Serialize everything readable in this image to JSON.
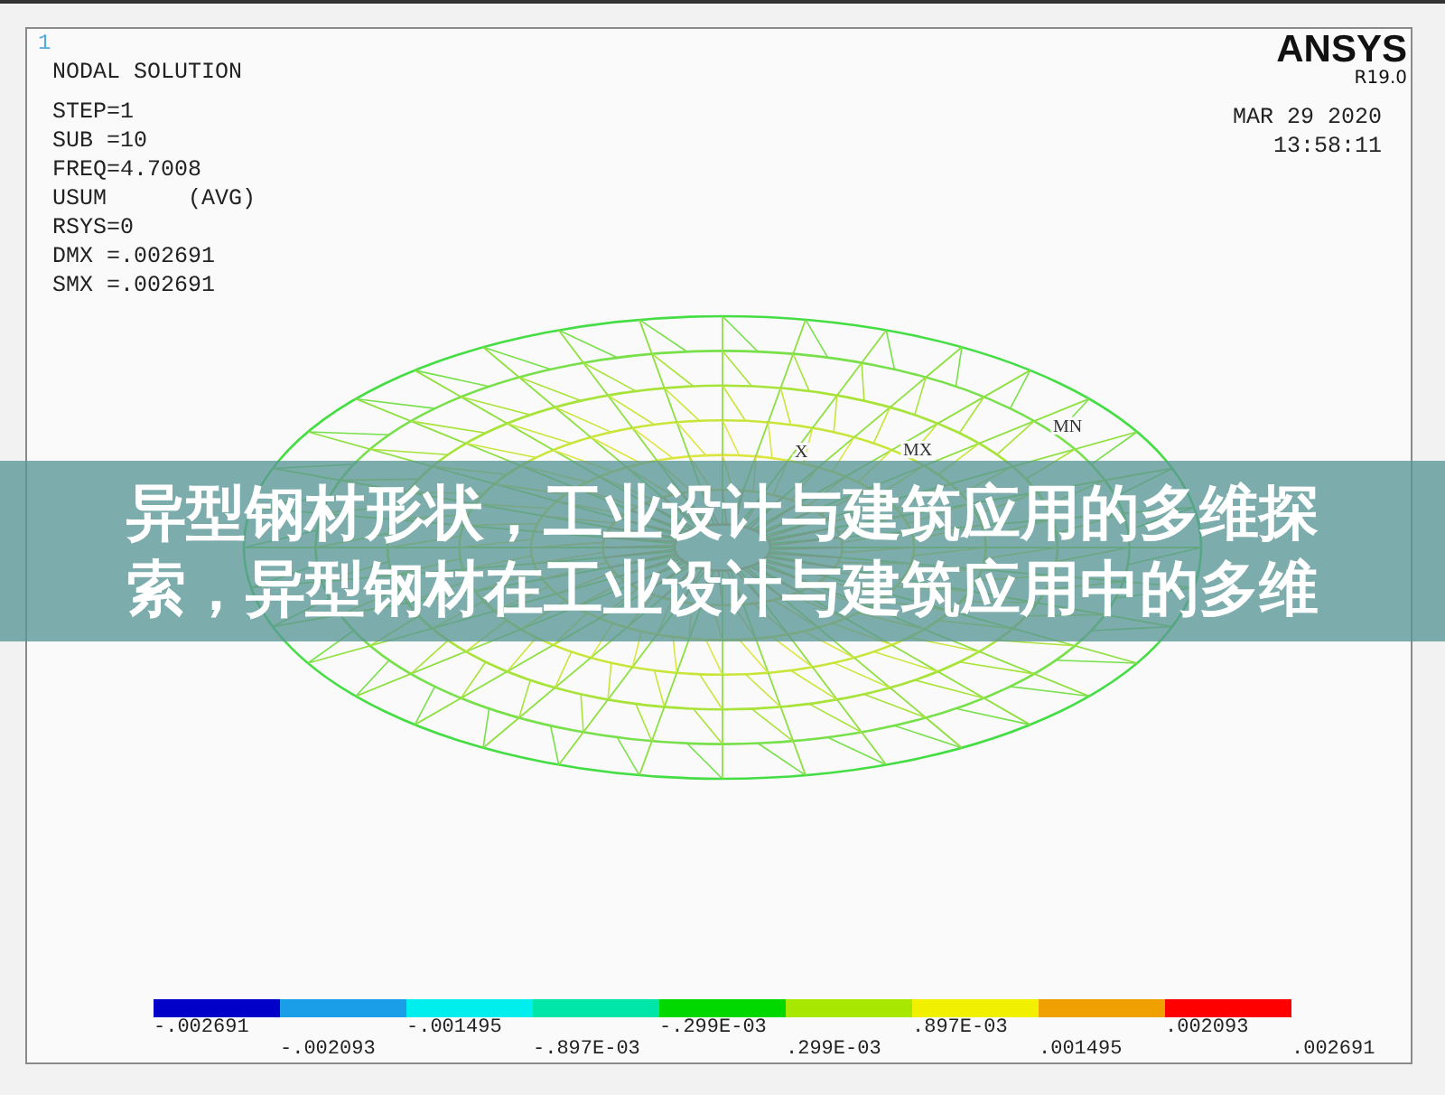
{
  "plot_number": "1",
  "title": "NODAL SOLUTION",
  "solution_info": [
    "STEP=1",
    "SUB =10",
    "FREQ=4.7008",
    "USUM      (AVG)",
    "RSYS=0",
    "DMX =.002691",
    "SMX =.002691"
  ],
  "logo": {
    "name": "ANSYS",
    "version": "R19.0"
  },
  "date": "MAR 29 2020",
  "time": "13:58:11",
  "plot_markers": [
    {
      "label": "MN"
    },
    {
      "label": "MX"
    },
    {
      "label": "X"
    }
  ],
  "legend": {
    "segments": [
      {
        "color": "#0000c8"
      },
      {
        "color": "#1a9ee8"
      },
      {
        "color": "#00eeee"
      },
      {
        "color": "#00e6a8"
      },
      {
        "color": "#00d800"
      },
      {
        "color": "#a8e800"
      },
      {
        "color": "#f0f000"
      },
      {
        "color": "#f0a000"
      },
      {
        "color": "#ff0000"
      }
    ],
    "labels": [
      "-.002691",
      "-.002093",
      "-.001495",
      "-.897E-03",
      "-.299E-03",
      ".299E-03",
      ".897E-03",
      ".001495",
      ".002093",
      ".002691"
    ]
  },
  "caption_banner": [
    "异型钢材形状，工业设计与建筑应用的多维探",
    "索，异型钢材在工业设计与建筑应用中的多维"
  ]
}
